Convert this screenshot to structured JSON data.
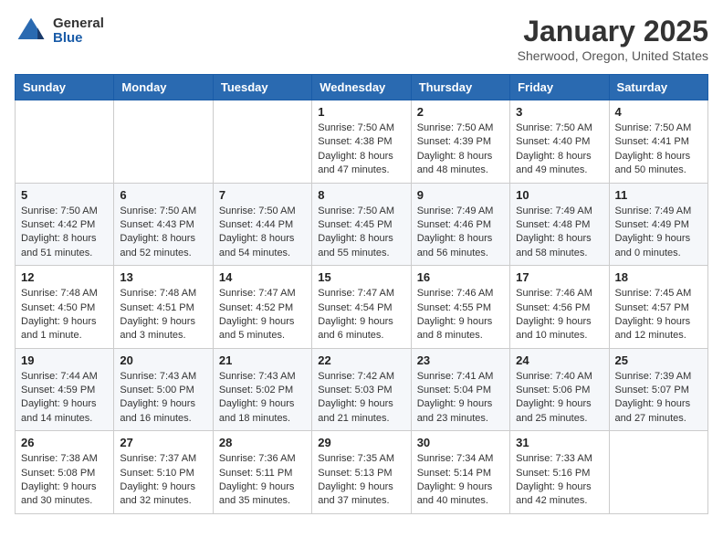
{
  "logo": {
    "general": "General",
    "blue": "Blue"
  },
  "header": {
    "title": "January 2025",
    "location": "Sherwood, Oregon, United States"
  },
  "weekdays": [
    "Sunday",
    "Monday",
    "Tuesday",
    "Wednesday",
    "Thursday",
    "Friday",
    "Saturday"
  ],
  "weeks": [
    [
      {
        "day": "",
        "info": ""
      },
      {
        "day": "",
        "info": ""
      },
      {
        "day": "",
        "info": ""
      },
      {
        "day": "1",
        "info": "Sunrise: 7:50 AM\nSunset: 4:38 PM\nDaylight: 8 hours and 47 minutes."
      },
      {
        "day": "2",
        "info": "Sunrise: 7:50 AM\nSunset: 4:39 PM\nDaylight: 8 hours and 48 minutes."
      },
      {
        "day": "3",
        "info": "Sunrise: 7:50 AM\nSunset: 4:40 PM\nDaylight: 8 hours and 49 minutes."
      },
      {
        "day": "4",
        "info": "Sunrise: 7:50 AM\nSunset: 4:41 PM\nDaylight: 8 hours and 50 minutes."
      }
    ],
    [
      {
        "day": "5",
        "info": "Sunrise: 7:50 AM\nSunset: 4:42 PM\nDaylight: 8 hours and 51 minutes."
      },
      {
        "day": "6",
        "info": "Sunrise: 7:50 AM\nSunset: 4:43 PM\nDaylight: 8 hours and 52 minutes."
      },
      {
        "day": "7",
        "info": "Sunrise: 7:50 AM\nSunset: 4:44 PM\nDaylight: 8 hours and 54 minutes."
      },
      {
        "day": "8",
        "info": "Sunrise: 7:50 AM\nSunset: 4:45 PM\nDaylight: 8 hours and 55 minutes."
      },
      {
        "day": "9",
        "info": "Sunrise: 7:49 AM\nSunset: 4:46 PM\nDaylight: 8 hours and 56 minutes."
      },
      {
        "day": "10",
        "info": "Sunrise: 7:49 AM\nSunset: 4:48 PM\nDaylight: 8 hours and 58 minutes."
      },
      {
        "day": "11",
        "info": "Sunrise: 7:49 AM\nSunset: 4:49 PM\nDaylight: 9 hours and 0 minutes."
      }
    ],
    [
      {
        "day": "12",
        "info": "Sunrise: 7:48 AM\nSunset: 4:50 PM\nDaylight: 9 hours and 1 minute."
      },
      {
        "day": "13",
        "info": "Sunrise: 7:48 AM\nSunset: 4:51 PM\nDaylight: 9 hours and 3 minutes."
      },
      {
        "day": "14",
        "info": "Sunrise: 7:47 AM\nSunset: 4:52 PM\nDaylight: 9 hours and 5 minutes."
      },
      {
        "day": "15",
        "info": "Sunrise: 7:47 AM\nSunset: 4:54 PM\nDaylight: 9 hours and 6 minutes."
      },
      {
        "day": "16",
        "info": "Sunrise: 7:46 AM\nSunset: 4:55 PM\nDaylight: 9 hours and 8 minutes."
      },
      {
        "day": "17",
        "info": "Sunrise: 7:46 AM\nSunset: 4:56 PM\nDaylight: 9 hours and 10 minutes."
      },
      {
        "day": "18",
        "info": "Sunrise: 7:45 AM\nSunset: 4:57 PM\nDaylight: 9 hours and 12 minutes."
      }
    ],
    [
      {
        "day": "19",
        "info": "Sunrise: 7:44 AM\nSunset: 4:59 PM\nDaylight: 9 hours and 14 minutes."
      },
      {
        "day": "20",
        "info": "Sunrise: 7:43 AM\nSunset: 5:00 PM\nDaylight: 9 hours and 16 minutes."
      },
      {
        "day": "21",
        "info": "Sunrise: 7:43 AM\nSunset: 5:02 PM\nDaylight: 9 hours and 18 minutes."
      },
      {
        "day": "22",
        "info": "Sunrise: 7:42 AM\nSunset: 5:03 PM\nDaylight: 9 hours and 21 minutes."
      },
      {
        "day": "23",
        "info": "Sunrise: 7:41 AM\nSunset: 5:04 PM\nDaylight: 9 hours and 23 minutes."
      },
      {
        "day": "24",
        "info": "Sunrise: 7:40 AM\nSunset: 5:06 PM\nDaylight: 9 hours and 25 minutes."
      },
      {
        "day": "25",
        "info": "Sunrise: 7:39 AM\nSunset: 5:07 PM\nDaylight: 9 hours and 27 minutes."
      }
    ],
    [
      {
        "day": "26",
        "info": "Sunrise: 7:38 AM\nSunset: 5:08 PM\nDaylight: 9 hours and 30 minutes."
      },
      {
        "day": "27",
        "info": "Sunrise: 7:37 AM\nSunset: 5:10 PM\nDaylight: 9 hours and 32 minutes."
      },
      {
        "day": "28",
        "info": "Sunrise: 7:36 AM\nSunset: 5:11 PM\nDaylight: 9 hours and 35 minutes."
      },
      {
        "day": "29",
        "info": "Sunrise: 7:35 AM\nSunset: 5:13 PM\nDaylight: 9 hours and 37 minutes."
      },
      {
        "day": "30",
        "info": "Sunrise: 7:34 AM\nSunset: 5:14 PM\nDaylight: 9 hours and 40 minutes."
      },
      {
        "day": "31",
        "info": "Sunrise: 7:33 AM\nSunset: 5:16 PM\nDaylight: 9 hours and 42 minutes."
      },
      {
        "day": "",
        "info": ""
      }
    ]
  ]
}
